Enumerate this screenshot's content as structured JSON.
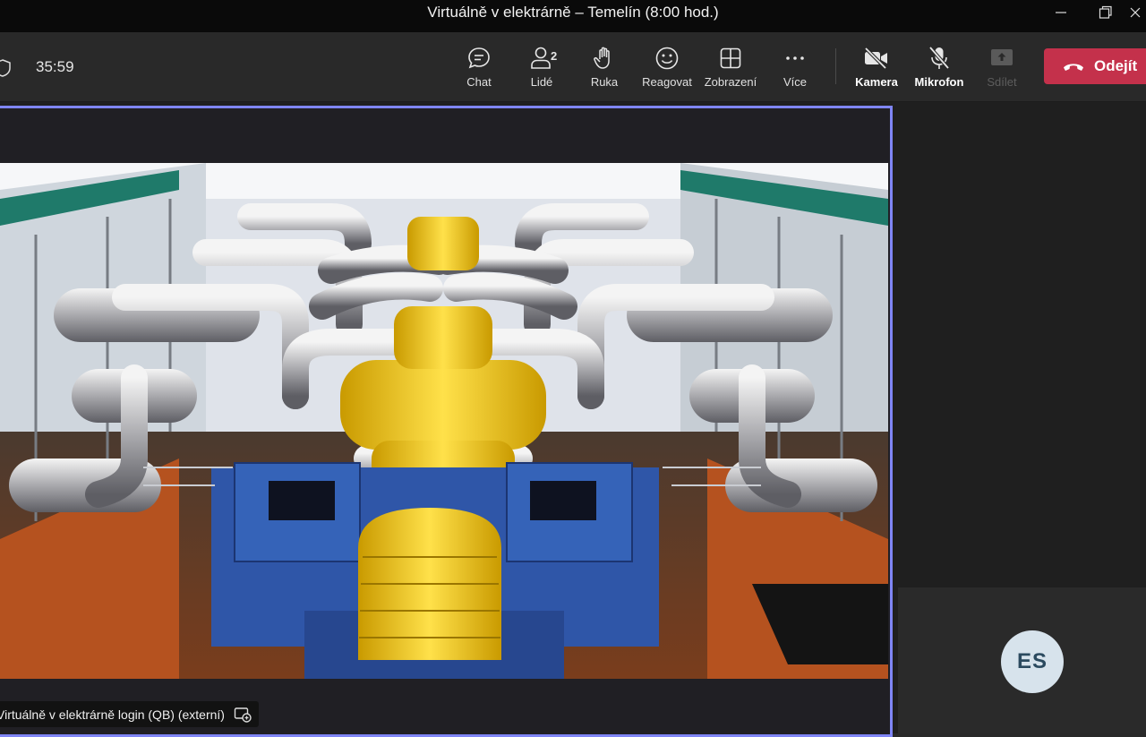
{
  "window": {
    "title": "Virtuálně v elektrárně – Temelín (8:00 hod.)"
  },
  "toolbar": {
    "timer": "35:59",
    "buttons": {
      "chat": "Chat",
      "people": "Lidé",
      "people_count": "2",
      "hand": "Ruka",
      "react": "Reagovat",
      "view": "Zobrazení",
      "more": "Více",
      "camera": "Kamera",
      "mic": "Mikrofon",
      "share": "Sdílet"
    },
    "leave_label": "Odejít"
  },
  "stage": {
    "participant_label": "Virtuálně v elektrárně login (QB) (externí)"
  },
  "side": {
    "avatar_initials": "ES"
  },
  "colors": {
    "accent_border": "#7f85f5",
    "leave_red": "#c4314b",
    "toolbar_bg": "#292929",
    "avatar_bg": "#d7e3ec"
  }
}
